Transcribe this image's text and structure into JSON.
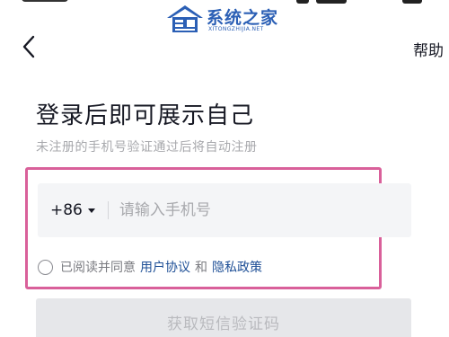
{
  "watermark": {
    "name_cn": "系统之家",
    "name_en": "XITONGZHIJIA.NET"
  },
  "nav": {
    "back_icon": "chevron-left-icon",
    "help_label": "帮助"
  },
  "login": {
    "title": "登录后即可展示自己",
    "subtitle": "未注册的手机号验证通过后将自动注册",
    "country_code": "+86",
    "phone_placeholder": "请输入手机号",
    "phone_value": "",
    "agreement_prefix": "已阅读并同意",
    "user_agreement_link": "用户协议",
    "agreement_and": "和",
    "privacy_policy_link": "隐私政策",
    "agreement_checked": false,
    "submit_label": "获取短信验证码"
  },
  "colors": {
    "highlight_frame": "#d9609a",
    "link": "#1e4f96",
    "input_bg": "#f4f5f7",
    "button_disabled_bg": "#e6e7ea",
    "watermark_blue": "#2b5fb5"
  }
}
